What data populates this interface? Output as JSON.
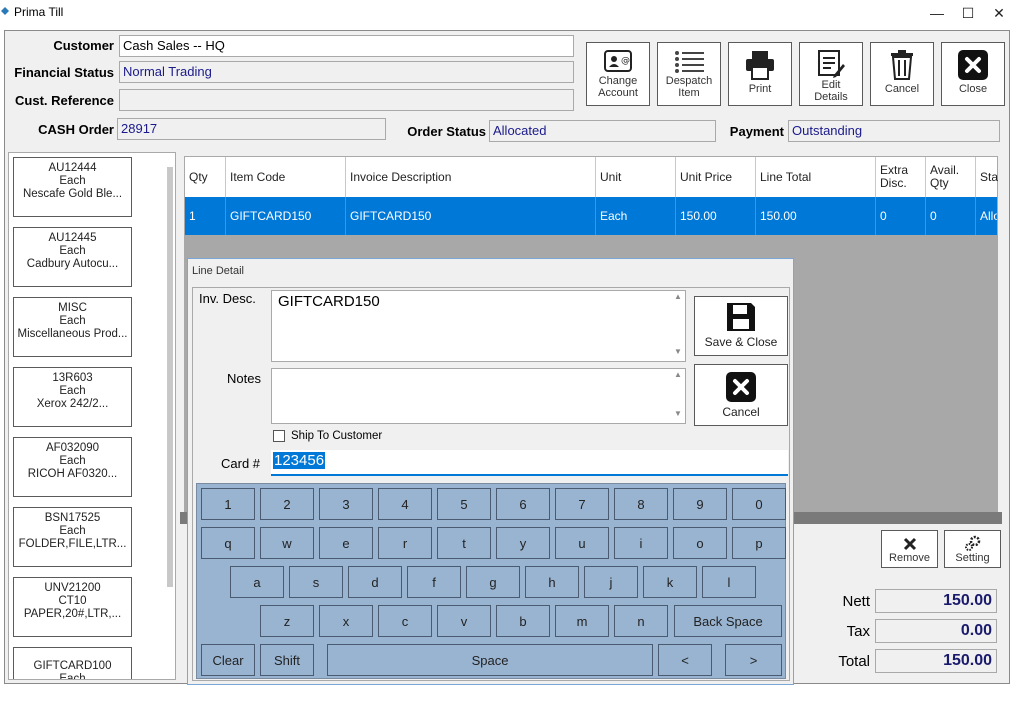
{
  "window": {
    "title": "Prima Till"
  },
  "header": {
    "customer_label": "Customer",
    "customer_value": "Cash Sales -- HQ",
    "financial_label": "Financial Status",
    "financial_value": "Normal Trading",
    "custref_label": "Cust. Reference",
    "custref_value": "",
    "cashorder_label": "CASH Order",
    "cashorder_value": "28917",
    "orderstatus_label": "Order Status",
    "orderstatus_value": "Allocated",
    "payment_label": "Payment",
    "payment_value": "Outstanding"
  },
  "toolbar": {
    "change_account_line1": "Change",
    "change_account_line2": "Account",
    "despatch_line1": "Despatch",
    "despatch_line2": "Item",
    "print": "Print",
    "edit_line1": "Edit",
    "edit_line2": "Details",
    "cancel": "Cancel",
    "close": "Close"
  },
  "products": [
    {
      "code": "AU12444",
      "unit": "Each",
      "desc": "Nescafe Gold Ble..."
    },
    {
      "code": "AU12445",
      "unit": "Each",
      "desc": "Cadbury Autocu..."
    },
    {
      "code": "MISC",
      "unit": "Each",
      "desc": "Miscellaneous Prod..."
    },
    {
      "code": "13R603",
      "unit": "Each",
      "desc": "Xerox 242/2..."
    },
    {
      "code": "AF032090",
      "unit": "Each",
      "desc": "RICOH AF0320..."
    },
    {
      "code": "BSN17525",
      "unit": "Each",
      "desc": "FOLDER,FILE,LTR..."
    },
    {
      "code": "UNV21200",
      "unit": "CT10",
      "desc": "PAPER,20#,LTR,..."
    },
    {
      "code": "GIFTCARD100",
      "unit": "Each",
      "desc": ""
    }
  ],
  "grid": {
    "headers": {
      "qty": "Qty",
      "code": "Item Code",
      "desc": "Invoice Description",
      "unit": "Unit",
      "price": "Unit Price",
      "total": "Line Total",
      "extra1": "Extra",
      "extra2": "Disc.",
      "avail1": "Avail.",
      "avail2": "Qty",
      "status": "Sta"
    },
    "row": {
      "qty": "1",
      "code": "GIFTCARD150",
      "desc": "GIFTCARD150",
      "unit": "Each",
      "price": "150.00",
      "total": "150.00",
      "extra": "0",
      "avail": "0",
      "status": "Allo"
    }
  },
  "side_buttons": {
    "remove": "Remove",
    "setting": "Setting"
  },
  "totals": {
    "nett_label": "Nett",
    "nett": "150.00",
    "tax_label": "Tax",
    "tax": "0.00",
    "total_label": "Total",
    "total": "150.00"
  },
  "dialog": {
    "title": "Line Detail",
    "invdesc_label": "Inv. Desc.",
    "invdesc_value": "GIFTCARD150",
    "notes_label": "Notes",
    "notes_value": "",
    "ship_label": "Ship To Customer",
    "card_label": "Card #",
    "card_value": "123456",
    "save_close": "Save & Close",
    "cancel": "Cancel"
  },
  "keyboard": {
    "row1": [
      "1",
      "2",
      "3",
      "4",
      "5",
      "6",
      "7",
      "8",
      "9",
      "0"
    ],
    "row2": [
      "q",
      "w",
      "e",
      "r",
      "t",
      "y",
      "u",
      "i",
      "o",
      "p"
    ],
    "row3": [
      "a",
      "s",
      "d",
      "f",
      "g",
      "h",
      "j",
      "k",
      "l"
    ],
    "row4": [
      "z",
      "x",
      "c",
      "v",
      "b",
      "m",
      "n"
    ],
    "backspace": "Back Space",
    "clear": "Clear",
    "shift": "Shift",
    "space": "Space",
    "left": "<",
    "right": ">"
  },
  "colors": {
    "selected_row": "#0078d7",
    "keyboard": "#99b4d1",
    "accent_text": "#1a1a8c"
  }
}
